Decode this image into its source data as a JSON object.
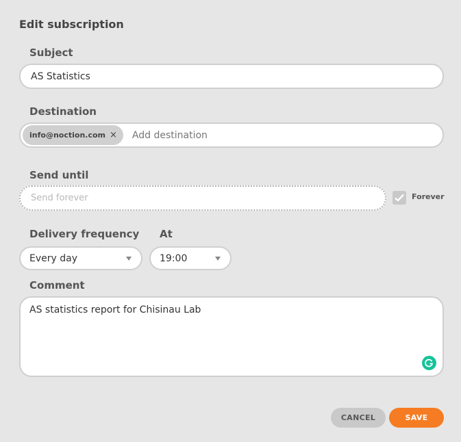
{
  "dialog": {
    "title": "Edit subscription"
  },
  "subject": {
    "label": "Subject",
    "value": "AS Statistics"
  },
  "destination": {
    "label": "Destination",
    "chips": [
      "info@noction.com"
    ],
    "chip_remove": "×",
    "placeholder": "Add destination"
  },
  "send_until": {
    "label": "Send until",
    "placeholder": "Send forever",
    "forever_label": "Forever",
    "forever_checked": true
  },
  "delivery": {
    "frequency_label": "Delivery frequency",
    "frequency_value": "Every day",
    "at_label": "At",
    "at_value": "19:00"
  },
  "comment": {
    "label": "Comment",
    "value": "AS statistics report for Chisinau Lab"
  },
  "buttons": {
    "cancel": "CANCEL",
    "save": "SAVE"
  },
  "colors": {
    "accent": "#f57c22",
    "grammarly": "#15c39a"
  },
  "icons": [
    "close-icon",
    "check-icon",
    "caret-down-icon",
    "grammarly-icon"
  ]
}
